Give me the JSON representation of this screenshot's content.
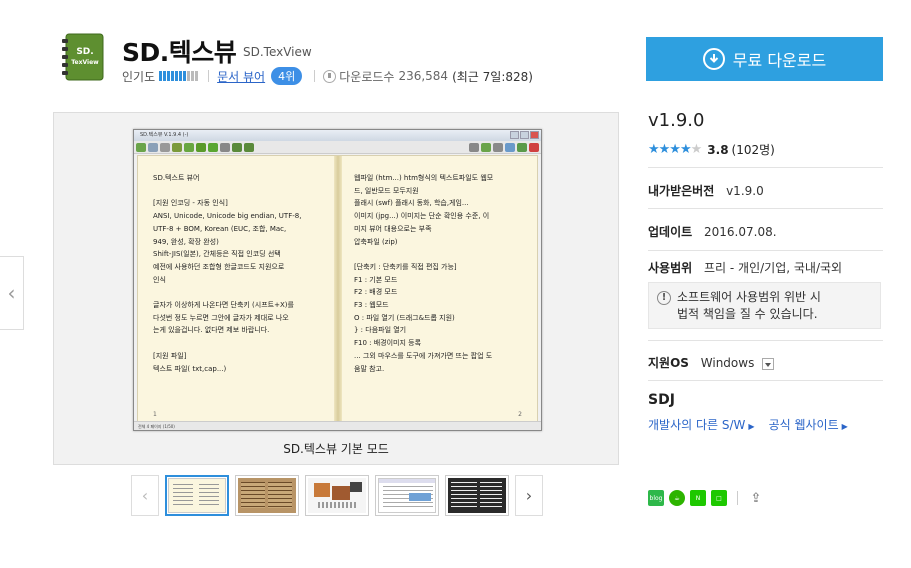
{
  "app": {
    "title": "SD.텍스뷰",
    "subtitle": "SD.TexView",
    "icon_text_1": "SD.",
    "icon_text_2": "TexView",
    "popularity_label": "인기도",
    "popularity_level": 0.7,
    "category": "문서 뷰어",
    "rank": "4위",
    "download_label": "다운로드수",
    "download_count": "236,584",
    "recent_downloads": "(최근 7일:828)"
  },
  "download_button": {
    "label": "무료 다운로드"
  },
  "screenshot": {
    "caption": "SD.텍스뷰 기본 모드",
    "window_title": "SD.텍스뷰 V.1.9.4 (-)",
    "left_page": "SD.텍스트 뷰어\n\n[지원 인코딩 - 자동 인식]\nANSI, Unicode, Unicode big endian, UTF-8,\nUTF-8 + BOM, Korean (EUC, 조합, Mac,\n949, 완성, 확장 완성)\nShift-JIS(일본), 간체등은 직접 인코딩 선택\n예전에 사용하던 조합형 한글코드도 지원으로\n인식\n\n글자가 이상하게 나온다면 단축키 (시프트+X)를\n다섯번 정도 누르면 그안에 글자가 제대로 나오\n는게 있을겁니다. 없다면 제보 바랍니다.\n\n[지원 파일]\n텍스트 파일( txt,cap...)",
    "right_page": "웹파일 (htm...) htm형식의 텍스트파일도 웹모\n드, 일반모드 모두지원\n플래시 (swf) 플래시 동화, 학습,게임...\n이미지 (jpg...) 이미지는 단순 확인용 수준, 이\n미지 뷰어 대용으로는 부족\n압축파일 (zip)\n\n[단축키 : 단축키를 직접 편집 가능]\nF1 : 기본 모드\nF2 : 배경 모드\nF3 : 웹모드\nO : 파일 열기 (드래그&드롭 지원)\n} : 다음파일 열기\nF10 : 배경이미지 등록\n... 그외 마우스를 도구에 가져가면 뜨는 팝업 도\n움말 참고.",
    "left_page_num": "1",
    "right_page_num": "2",
    "status_text": "전체 4 페이지 (1/50)"
  },
  "thumbnails": [
    {
      "label": "thumb-1",
      "active": true
    },
    {
      "label": "thumb-2",
      "active": false
    },
    {
      "label": "thumb-3",
      "active": false
    },
    {
      "label": "thumb-4",
      "active": false
    },
    {
      "label": "thumb-5",
      "active": false
    }
  ],
  "info": {
    "version": "v1.9.0",
    "rating_score": "3.8",
    "rating_count": "(102명)",
    "rating_fraction": 0.76,
    "my_version_label": "내가받은버전",
    "my_version_value": "v1.9.0",
    "update_label": "업데이트",
    "update_value": "2016.07.08.",
    "license_label": "사용범위",
    "license_value": "프리 - 개인/기업, 국내/국외",
    "notice_line1": "소프트웨어 사용범위 위반 시",
    "notice_line2": "법적 책임을 질 수 있습니다.",
    "os_label": "지원OS",
    "os_value": "Windows",
    "developer": "SDJ",
    "dev_link_1": "개발사의 다른 S/W",
    "dev_link_2": "공식 웹사이트"
  },
  "colors": {
    "accent": "#2ea0e0",
    "link": "#2b65c8",
    "icon_green": "#6a9c3a"
  }
}
